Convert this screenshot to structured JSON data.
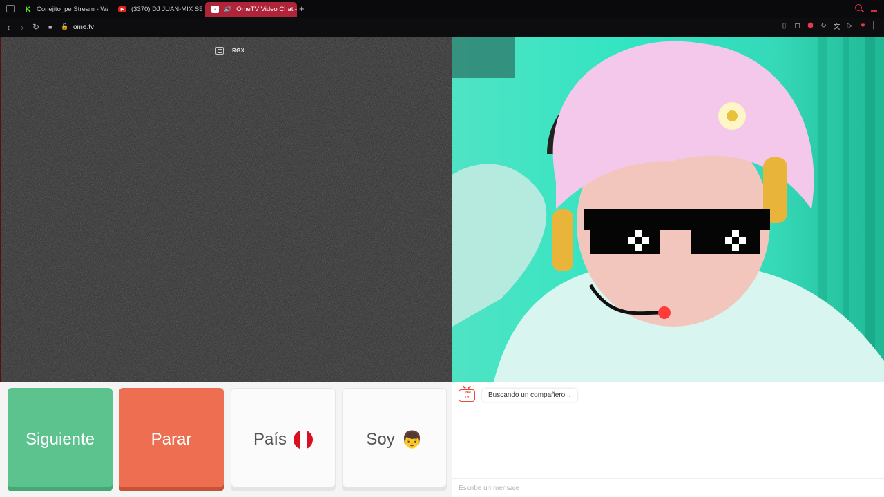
{
  "browser": {
    "tabs": [
      {
        "title": "Conejito_pe Stream - Wat",
        "icon": "kick-favicon",
        "active": false
      },
      {
        "title": "(3370) DJ JUAN-MIX SE",
        "icon": "youtube-favicon",
        "active": false
      },
      {
        "title": "OmeTV Video Chat —",
        "icon": "ometv-favicon",
        "active": true
      }
    ],
    "new_tab": "+",
    "url": "ome.tv"
  },
  "video_left": {
    "overlay_label": "RGX",
    "state": "static noise"
  },
  "controls": {
    "next_label": "Siguiente",
    "stop_label": "Parar",
    "country_label": "País",
    "country_flag": "peru-flag",
    "gender_label": "Soy",
    "gender_icon": "boy-emoji"
  },
  "chat": {
    "status_message": "Buscando un compañero...",
    "input_placeholder": "Escribe un mensaje",
    "input_value": ""
  },
  "colors": {
    "next": "#5cc38e",
    "stop": "#ee6e52",
    "active_tab": "#b0243a",
    "accent_red": "#e23a4e"
  }
}
